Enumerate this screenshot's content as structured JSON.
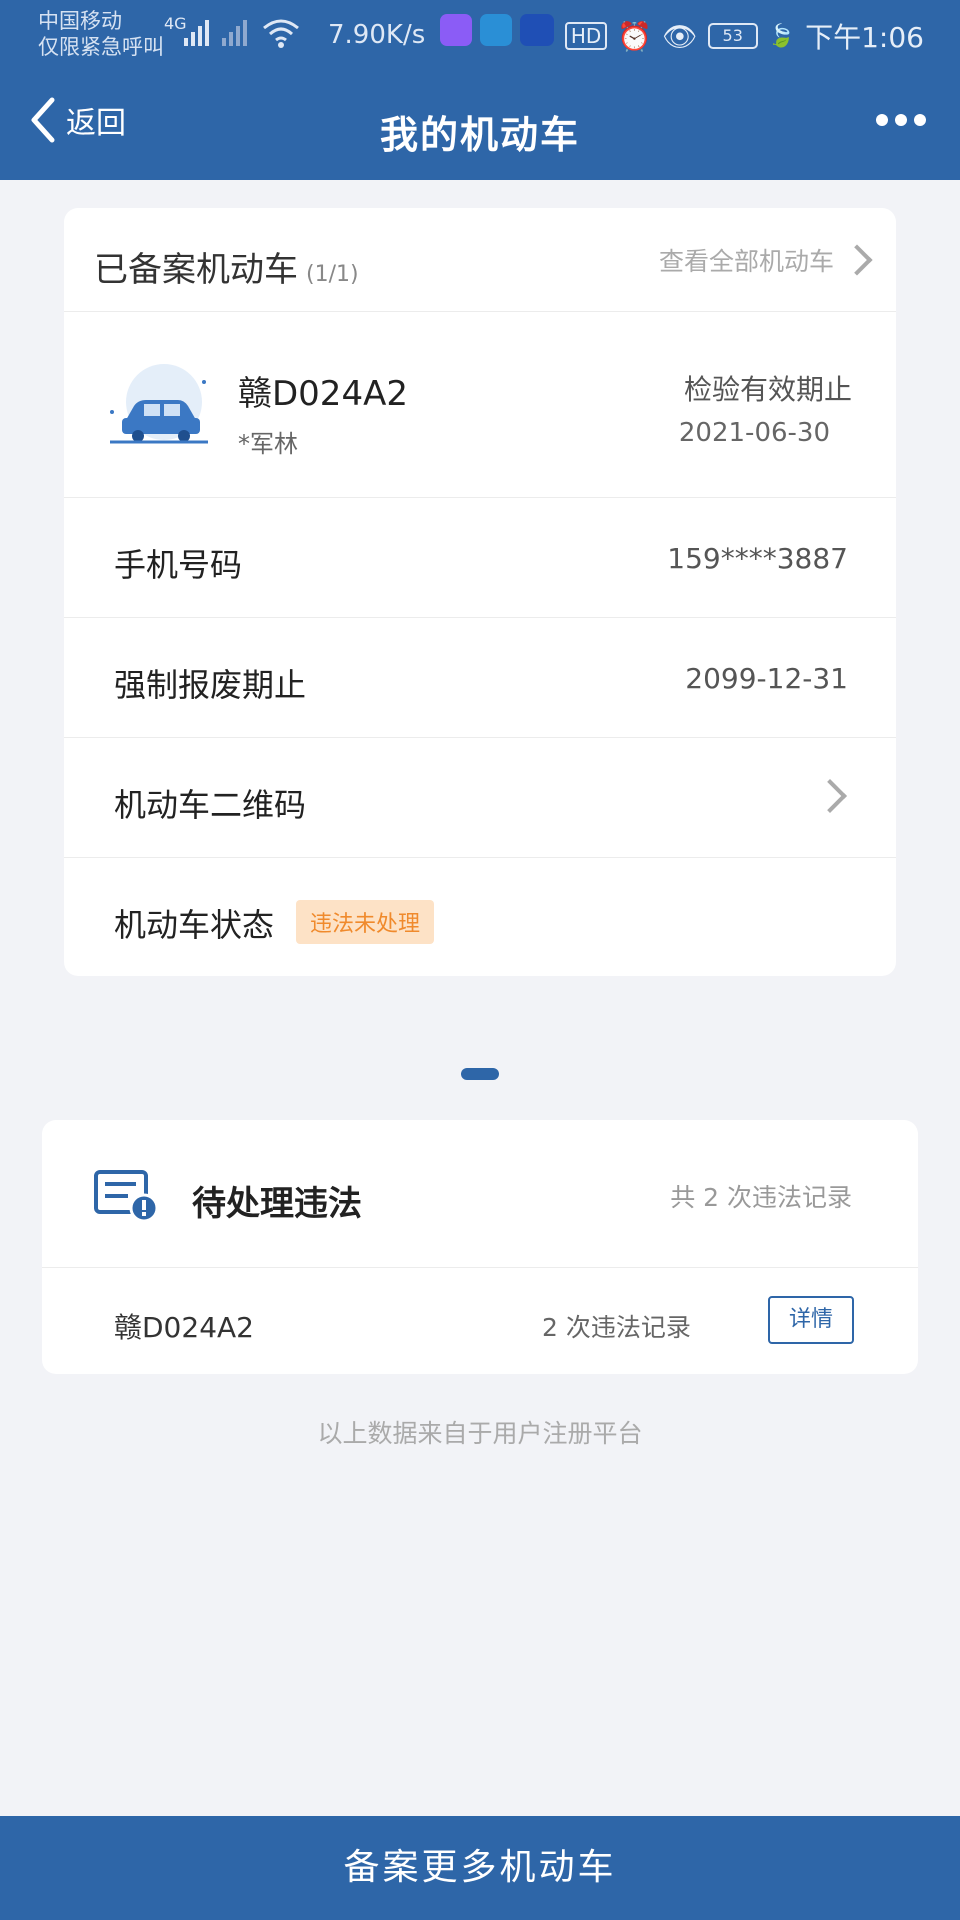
{
  "status_bar": {
    "carrier_line1": "中国移动",
    "carrier_line2": "仅限紧急呼叫",
    "net_type": "4G",
    "net_speed": "7.90K/s",
    "hd": "HD",
    "battery": "53",
    "time": "下午1:06"
  },
  "header": {
    "back_label": "返回",
    "title": "我的机动车"
  },
  "vehicle_card": {
    "title": "已备案机动车",
    "count": "(1/1)",
    "view_all": "查看全部机动车",
    "plate": "赣D024A2",
    "owner": "*军林",
    "inspection_label": "检验有效期止",
    "inspection_date": "2021-06-30",
    "rows": [
      {
        "label": "手机号码",
        "value": "159****3887"
      },
      {
        "label": "强制报废期止",
        "value": "2099-12-31"
      },
      {
        "label": "机动车二维码",
        "value": ""
      },
      {
        "label": "机动车状态",
        "badge": "违法未处理"
      }
    ]
  },
  "violations_card": {
    "title": "待处理违法",
    "total": "共 2 次违法记录",
    "plate": "赣D024A2",
    "count": "2 次违法记录",
    "detail_button": "详情"
  },
  "footnote": "以上数据来自于用户注册平台",
  "bottom_button": "备案更多机动车",
  "colors": {
    "primary": "#2e66a8",
    "badge_bg": "#fde2c6",
    "badge_text": "#f08a2c",
    "background": "#f2f3f7"
  },
  "icons": [
    "chevron-left-icon",
    "more-icon",
    "chevron-right-icon",
    "car-icon",
    "document-alert-icon",
    "wifi-icon",
    "signal-icon",
    "eye-icon",
    "alarm-icon",
    "leaf-icon"
  ]
}
